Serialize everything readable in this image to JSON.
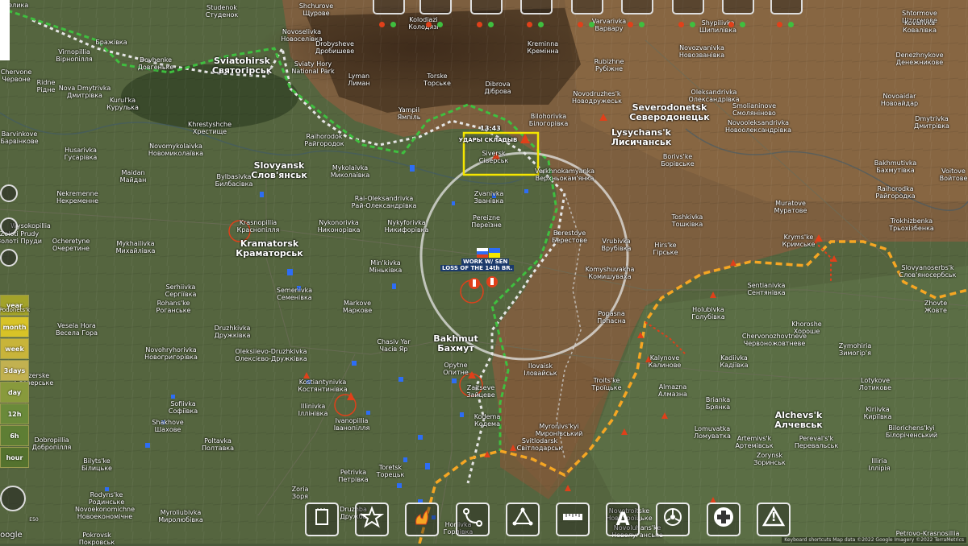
{
  "map": {
    "cities": [
      {
        "id": "velika",
        "lat": "Велика",
        "cyr": ""
      },
      {
        "id": "studenok",
        "lat": "Studenok",
        "cyr": "Студенок"
      },
      {
        "id": "shchurove",
        "lat": "Shchurove",
        "cyr": "Щурове"
      },
      {
        "id": "kolodiazi",
        "lat": "Kolodiazi",
        "cyr": "Колодязі"
      },
      {
        "id": "varvarivka",
        "lat": "Varvarivka",
        "cyr": "Варвару"
      },
      {
        "id": "shypilivka",
        "lat": "Shypilivka",
        "cyr": "Шипилівка"
      },
      {
        "id": "shtormove",
        "lat": "Shtormove",
        "cyr": "Штормове"
      },
      {
        "id": "kovalivka",
        "lat": "Kovalivka",
        "cyr": "Ковалівка"
      },
      {
        "id": "vchrupnia",
        "lat": "Бражівка",
        "cyr": ""
      },
      {
        "id": "virnopillia",
        "lat": "Virnopillia",
        "cyr": "Вірнопілля"
      },
      {
        "id": "dovherike",
        "lat": "Dovhenke",
        "cyr": "Довгеньке"
      },
      {
        "id": "sviatohirsk",
        "lat": "Sviatohirsk",
        "cyr": "Святогірськ"
      },
      {
        "id": "novoselivka",
        "lat": "Novoselivka",
        "cyr": "Новоселівка"
      },
      {
        "id": "drobysheve",
        "lat": "Drobysheve",
        "cyr": "Дробишеве"
      },
      {
        "id": "kreminna",
        "lat": "Kreminna",
        "cyr": "Кремінна"
      },
      {
        "id": "rubizhne",
        "lat": "Rubizhne",
        "cyr": "Рубіжне"
      },
      {
        "id": "novozvanivka",
        "lat": "Novozvanivka",
        "cyr": "Новозванівка"
      },
      {
        "id": "denezhnykove",
        "lat": "Denezhnykove",
        "cyr": "Денежникове"
      },
      {
        "id": "chervone",
        "lat": "Chervone",
        "cyr": "Червоне"
      },
      {
        "id": "ridne",
        "lat": "Ridne",
        "cyr": "Рідне"
      },
      {
        "id": "nova_dmytrivka",
        "lat": "Nova Dmytrivka",
        "cyr": "Дмитрівка"
      },
      {
        "id": "kurulka",
        "lat": "Kurul'ka",
        "cyr": "Курулька"
      },
      {
        "id": "lyman",
        "lat": "Lyman",
        "cyr": "Лиман"
      },
      {
        "id": "torske",
        "lat": "Torske",
        "cyr": "Торське"
      },
      {
        "id": "dibrova",
        "lat": "Dibrova",
        "cyr": "Діброва"
      },
      {
        "id": "novodruzhesk",
        "lat": "Novodruzhes'k",
        "cyr": "Новодружеськ"
      },
      {
        "id": "severodonetsk",
        "lat": "Severodonetsk",
        "cyr": "Северодонецьк"
      },
      {
        "id": "oleksandrivka",
        "lat": "Oleksandrivka",
        "cyr": "Олександрівка"
      },
      {
        "id": "smolianinove",
        "lat": "Smolianinove",
        "cyr": "Смоляніново"
      },
      {
        "id": "novoaidar",
        "lat": "Novoaidar",
        "cyr": "Новоайдар"
      },
      {
        "id": "barvinkove",
        "lat": "Barvinkove",
        "cyr": "Барвінкове"
      },
      {
        "id": "khrestyshche",
        "lat": "Khrestyshche",
        "cyr": "Хрестище"
      },
      {
        "id": "raihorodok",
        "lat": "Raihorodok",
        "cyr": "Райгородок"
      },
      {
        "id": "yampil",
        "lat": "Yampil",
        "cyr": "Ямпіль"
      },
      {
        "id": "bilohorivka",
        "lat": "Bilohorivka",
        "cyr": "Білогорівка"
      },
      {
        "id": "lysychansk",
        "lat": "Lysychans'k",
        "cyr": "Лисичанськ"
      },
      {
        "id": "novooleksandrivka",
        "lat": "Novooleksandrivka",
        "cyr": "Новоолександрівка"
      },
      {
        "id": "dmytrivka",
        "lat": "Dmytrivka",
        "cyr": "Дмитрівка"
      },
      {
        "id": "novomykolaivka",
        "lat": "Novomykolaivka",
        "cyr": "Новомиколаївка"
      },
      {
        "id": "husarivka",
        "lat": "Husarivka",
        "cyr": "Гусарівка"
      },
      {
        "id": "slovyansk",
        "lat": "Slovyansk",
        "cyr": "Слов'янськ"
      },
      {
        "id": "mykolaivka",
        "lat": "Mykolaivka",
        "cyr": "Миколаївка"
      },
      {
        "id": "siversk",
        "lat": "Siversk",
        "cyr": "Сіверськ"
      },
      {
        "id": "verkhnokamianka",
        "lat": "Verkhnokamyanka",
        "cyr": "Верхньокам'янка"
      },
      {
        "id": "borivske",
        "lat": "Borivs'ke",
        "cyr": "Борівське"
      },
      {
        "id": "bakhmutivka",
        "lat": "Bakhmutivka",
        "cyr": "Бахмутівка"
      },
      {
        "id": "voitove",
        "lat": "Voitove",
        "cyr": "Войтове"
      },
      {
        "id": "bylbasivka",
        "lat": "Bylbasivka",
        "cyr": "Билбасівка"
      },
      {
        "id": "maidan",
        "lat": "Maidan",
        "cyr": "Майдан"
      },
      {
        "id": "raj_oleksandrivka",
        "lat": "Rai-Oleksandrivka",
        "cyr": "Рай-Олександрівка"
      },
      {
        "id": "zvanivka",
        "lat": "Zvanivka",
        "cyr": "Званівка"
      },
      {
        "id": "raihorodka",
        "lat": "Raihorodka",
        "cyr": "Райгородка"
      },
      {
        "id": "nekremenne",
        "lat": "Nekremenne",
        "cyr": "Некременне"
      },
      {
        "id": "muratove",
        "lat": "Muratove",
        "cyr": "Муратове"
      },
      {
        "id": "wysokopillia",
        "lat": "Wysokopillia",
        "cyr": ""
      },
      {
        "id": "krasnopillia",
        "lat": "Krasnopillia",
        "cyr": "Краснопілля"
      },
      {
        "id": "nykonorivka",
        "lat": "Nykonorivka",
        "cyr": "Никонорівка"
      },
      {
        "id": "nykyforivka",
        "lat": "Nykyforivka",
        "cyr": "Никифорівка"
      },
      {
        "id": "pereizne",
        "lat": "Pereizne",
        "cyr": "Переїзне"
      },
      {
        "id": "toshkivka",
        "lat": "Toshkivka",
        "cyr": "Тошківка"
      },
      {
        "id": "trokhizbenka",
        "lat": "Trokhizbenka",
        "cyr": "Трьохізбенка"
      },
      {
        "id": "zoloti_prudy",
        "lat": "Zoloti Prudy",
        "cyr": "Золоті Пруди"
      },
      {
        "id": "ocheretyne",
        "lat": "Ocheretyne",
        "cyr": "Очеретине"
      },
      {
        "id": "mykhailivka",
        "lat": "Mykhailivka",
        "cyr": "Михайлівка"
      },
      {
        "id": "kramatorsk",
        "lat": "Kramatorsk",
        "cyr": "Краматорськ"
      },
      {
        "id": "minkivka",
        "lat": "Min'kivka",
        "cyr": "Міньківка"
      },
      {
        "id": "berestove",
        "lat": "Berestove",
        "cyr": "Берестове"
      },
      {
        "id": "vrubivka",
        "lat": "Vrubivka",
        "cyr": "Врубівка"
      },
      {
        "id": "hirske",
        "lat": "Hirs'ke",
        "cyr": "Гірське"
      },
      {
        "id": "krymske",
        "lat": "Kryms'ke",
        "cyr": "Кримське"
      },
      {
        "id": "slovianoserbsk",
        "lat": "Slovyanoserbs'k",
        "cyr": "Слов'яносербськ"
      },
      {
        "id": "komyshuvakha",
        "lat": "Komyshuvakha",
        "cyr": "Комишуваха"
      },
      {
        "id": "sentianivka",
        "lat": "Sentianivka",
        "cyr": "Сентянівка"
      },
      {
        "id": "semenivka",
        "lat": "Semenivka",
        "cyr": "Семенівка"
      },
      {
        "id": "serhivka",
        "lat": "Serhiivka",
        "cyr": "Сергіївка"
      },
      {
        "id": "rohanske",
        "lat": "Rohans'ke",
        "cyr": "Роганське"
      },
      {
        "id": "markove",
        "lat": "Markove",
        "cyr": "Маркове"
      },
      {
        "id": "popasna",
        "lat": "Popasna",
        "cyr": "Попасна"
      },
      {
        "id": "holubivka",
        "lat": "Holubivka",
        "cyr": "Голубівка"
      },
      {
        "id": "zhovte",
        "lat": "Zhovte",
        "cyr": "Жовте"
      },
      {
        "id": "khoroshe",
        "lat": "Khoroshe",
        "cyr": "Хороше"
      },
      {
        "id": "vesela_hora",
        "lat": "Vesela Hora",
        "cyr": "Весела Гора"
      },
      {
        "id": "druzhkivka",
        "lat": "Druzhkivka",
        "cyr": "Дружківка"
      },
      {
        "id": "chasiv_yar",
        "lat": "Chasiv Yar",
        "cyr": "Часів Яр"
      },
      {
        "id": "bakhmut",
        "lat": "Bakhmut",
        "cyr": "Бахмут"
      },
      {
        "id": "chervonozhovtneve",
        "lat": "Chervonozhovtneve",
        "cyr": "Червоножовтневе"
      },
      {
        "id": "zymohiria",
        "lat": "Zymohiria",
        "cyr": "Зимогір'я"
      },
      {
        "id": "novohryhorivka",
        "lat": "Novohryhorivka",
        "cyr": "Новогригорівка"
      },
      {
        "id": "oleksiievo",
        "lat": "Oleksiievo-Druzhkivka",
        "cyr": "Олексієво-Дружківка"
      },
      {
        "id": "kalynove",
        "lat": "Kalynove",
        "cyr": "Калинове"
      },
      {
        "id": "kadiivka",
        "lat": "Kadiivka",
        "cyr": "Кадіївка"
      },
      {
        "id": "lotykove",
        "lat": "Lotykove",
        "cyr": "Лотикове"
      },
      {
        "id": "blozerske",
        "lat": "Blozerske",
        "cyr": "Блозерське"
      },
      {
        "id": "kostiantynivka",
        "lat": "Kostiantynivka",
        "cyr": "Костянтинівка"
      },
      {
        "id": "opytne",
        "lat": "Opytne",
        "cyr": "Опитне"
      },
      {
        "id": "ilovaisk",
        "lat": "Ilovaisk",
        "cyr": "Іловайськ"
      },
      {
        "id": "zaitseve",
        "lat": "Zaitseve",
        "cyr": "Зайцеве"
      },
      {
        "id": "troitske",
        "lat": "Troits'ke",
        "cyr": "Троїцьке"
      },
      {
        "id": "almazna",
        "lat": "Almazna",
        "cyr": "Алмазна"
      },
      {
        "id": "sofiivka",
        "lat": "Sofiivka",
        "cyr": "Софіївка"
      },
      {
        "id": "illinivka",
        "lat": "Illinivka",
        "cyr": "Іллінівка"
      },
      {
        "id": "brianka",
        "lat": "Brianka",
        "cyr": "Брянка"
      },
      {
        "id": "kiriivka",
        "lat": "Kiriivka",
        "cyr": "Кирїївка"
      },
      {
        "id": "alchevsk",
        "lat": "Alchevs'k",
        "cyr": "Алчевськ"
      },
      {
        "id": "shakhove",
        "lat": "Shakhove",
        "cyr": "Шахове"
      },
      {
        "id": "ivanopillia",
        "lat": "Ivanopillia",
        "cyr": "Іванопілля"
      },
      {
        "id": "dobropillia",
        "lat": "Dobropillia",
        "cyr": "Добропілля"
      },
      {
        "id": "poltavka",
        "lat": "Poltavka",
        "cyr": "Полтавка"
      },
      {
        "id": "kodema",
        "lat": "Kodema",
        "cyr": "Кодема"
      },
      {
        "id": "myronivsky",
        "lat": "Myronivs'kyi",
        "cyr": "Миронівський"
      },
      {
        "id": "lomuvatka",
        "lat": "Lomuvatka",
        "cyr": "Ломуватка"
      },
      {
        "id": "artemivsk",
        "lat": "Artemivs'k",
        "cyr": "Артемівськ"
      },
      {
        "id": "perevalsk",
        "lat": "Pereval's'k",
        "cyr": "Перевальськ"
      },
      {
        "id": "biloricheny",
        "lat": "Bilorichens'kyi",
        "cyr": "Білоріченський"
      },
      {
        "id": "svitlodarsk",
        "lat": "Svitlodarsk",
        "cyr": "Світлодарськ"
      },
      {
        "id": "bilytske",
        "lat": "Bilyts'ke",
        "cyr": "Білицьке"
      },
      {
        "id": "zorynsk",
        "lat": "Zorynsk",
        "cyr": "Зоринськ"
      },
      {
        "id": "illiria",
        "lat": "Illiria",
        "cyr": "Іллірія"
      },
      {
        "id": "toretsk",
        "lat": "Toretsk",
        "cyr": "Торецьк"
      },
      {
        "id": "petrivka",
        "lat": "Petrivka",
        "cyr": "Петрівка"
      },
      {
        "id": "zoria",
        "lat": "Zoria",
        "cyr": "Зоря"
      },
      {
        "id": "rodynske",
        "lat": "Rodyns'ke",
        "cyr": "Родинське"
      },
      {
        "id": "novoekonomichne",
        "lat": "Novoekonomichne",
        "cyr": "Новоекономічне"
      },
      {
        "id": "myrolubivka",
        "lat": "Myroliubivka",
        "cyr": "Миролюбівка"
      },
      {
        "id": "druzhba",
        "lat": "Druzhba",
        "cyr": "Дружба"
      },
      {
        "id": "novotroitske",
        "lat": "Novotroitske",
        "cyr": "Новотроїцьке"
      },
      {
        "id": "horlivka",
        "lat": "Horlivka",
        "cyr": "Горлівка"
      },
      {
        "id": "pokrovsk",
        "lat": "Pokrovsk",
        "cyr": "Покровськ"
      },
      {
        "id": "petrovo_krasnosillia",
        "lat": "Petrovo-Krasnosillia",
        "cyr": ""
      },
      {
        "id": "novoluhanske",
        "lat": "Novoluhans'ke",
        "cyr": "Новолуганське"
      }
    ],
    "annotations": {
      "sviatohirsk_park_title": "Sviaty Hory",
      "sviatohirsk_park_sub": "National Park",
      "strike_time": "13:43",
      "strike_label": "УДАРЫ СКЛАДЫВ",
      "event_label": "LOSS OF THE 14th BR.",
      "event_small": "WORK W/ SEN"
    },
    "colors": {
      "rus_line": "#f5a623",
      "ukr_line": "#3fbf3f",
      "uke_frontline": "#e6e6e6",
      "highlight_box": "#f5e600",
      "ukr_unit": "#2d6df5",
      "rus_unit": "#e0401a"
    }
  },
  "sidebar": {
    "timeline": [
      {
        "label": "year",
        "color": "#a3a32a"
      },
      {
        "label": "month",
        "color": "#d8c327"
      },
      {
        "label": "week",
        "color": "#c8b43a"
      },
      {
        "label": "3days",
        "color": "#c2b150"
      },
      {
        "label": "day",
        "color": "#889a3c"
      },
      {
        "label": "12h",
        "color": "#6a8a3a"
      },
      {
        "label": "6h",
        "color": "#5e7e34"
      },
      {
        "label": "hour",
        "color": "#54722e"
      }
    ],
    "timeline_extra": "Podonets'k"
  },
  "toolbar": {
    "top_buttons": [
      "box-icon",
      "truck-icon",
      "tank-icon",
      "artillery-icon",
      "flag-icon",
      "helicopter-icon",
      "apc-icon",
      "missile-icon",
      "aircraft-icon"
    ],
    "bottom_buttons": [
      {
        "name": "notes-icon",
        "label": ""
      },
      {
        "name": "star-icon",
        "label": ""
      },
      {
        "name": "fire-icon",
        "label": ""
      },
      {
        "name": "route-icon",
        "label": ""
      },
      {
        "name": "triangle-icon",
        "label": ""
      },
      {
        "name": "ruler-icon",
        "label": ""
      },
      {
        "name": "text-icon",
        "label": "A"
      },
      {
        "name": "biohazard-icon",
        "label": ""
      },
      {
        "name": "medical-icon",
        "label": ""
      },
      {
        "name": "warning-icon",
        "label": "!"
      }
    ]
  },
  "footer": {
    "shortcuts": "Keyboard shortcuts",
    "attribution": "Map data ©2022 Google Imagery ©2022 TerraMetrics",
    "google": "Google",
    "e50": "E50"
  }
}
